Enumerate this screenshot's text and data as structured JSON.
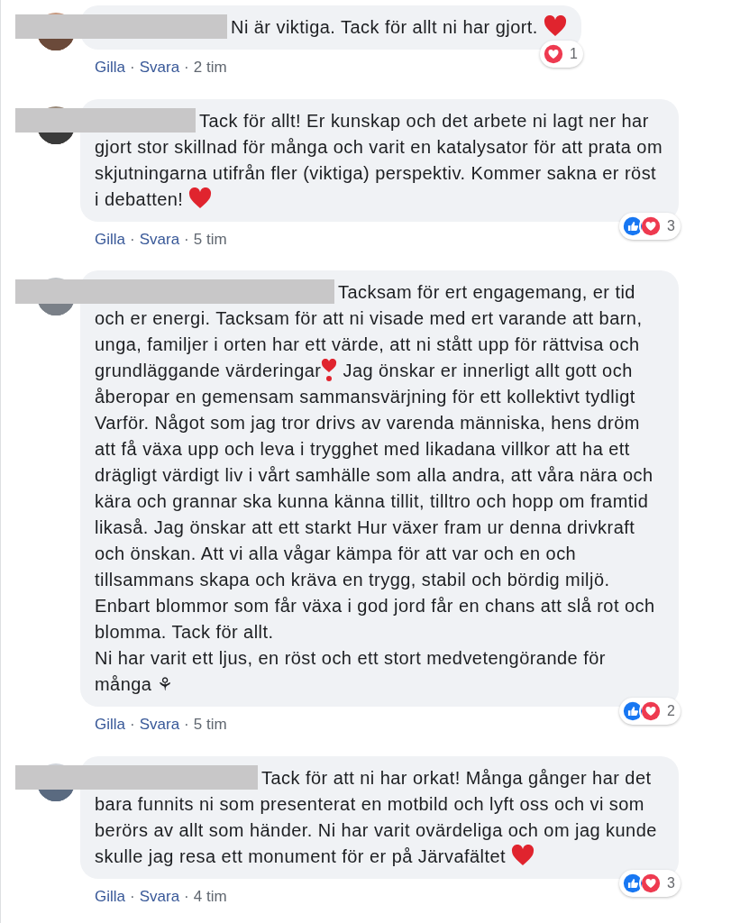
{
  "comments": [
    {
      "avatar": {
        "kind": "picture"
      },
      "name_redacted": true,
      "paragraphs": [
        [
          {
            "kind": "text",
            "text": "Ni är viktiga. Tack för allt ni har gjort. "
          },
          {
            "kind": "heart"
          }
        ]
      ],
      "reactions": {
        "icons": [
          {
            "kind": "love"
          }
        ],
        "count": "1"
      },
      "actions": {
        "like": "Gilla",
        "reply": "Svara",
        "separator": "·",
        "time": "2 tim"
      }
    },
    {
      "avatar": {
        "kind": "picture"
      },
      "name_redacted": true,
      "paragraphs": [
        [
          {
            "kind": "text",
            "text": "Tack för allt! Er kunskap och det arbete ni lagt ner har gjort stor skillnad för många och varit en katalysator för att prata om skjutningarna utifrån fler (viktiga) perspektiv. Kommer sakna er röst i debatten! "
          },
          {
            "kind": "heart"
          }
        ]
      ],
      "reactions": {
        "icons": [
          {
            "kind": "like"
          },
          {
            "kind": "love"
          }
        ],
        "count": "3"
      },
      "actions": {
        "like": "Gilla",
        "reply": "Svara",
        "separator": "·",
        "time": "5 tim"
      }
    },
    {
      "avatar": {
        "kind": "picture"
      },
      "name_redacted": true,
      "paragraphs": [
        [
          {
            "kind": "text",
            "text": "Tacksam för ert engagemang, er tid och er energi. Tacksam för att ni visade med ert varande att barn, unga, familjer i orten har ett värde, att ni stått upp för rättvisa och grundläggande värderingar"
          },
          {
            "kind": "exclamation"
          },
          {
            "kind": "text",
            "text": " Jag önskar er innerligt allt gott och åberopar en gemensam sammansvärjning för ett kollektivt tydligt Varför. Något som jag tror drivs av varenda människa, hens dröm att få växa upp och leva i trygghet med likadana villkor att ha ett drägligt värdigt liv i vårt samhälle som alla andra, att våra nära och kära och grannar ska kunna känna tillit, tilltro och hopp om framtid likaså. Jag önskar att ett starkt Hur växer fram ur denna drivkraft och önskan. Att vi alla vågar kämpa för att var och en och tillsammans skapa och kräva en trygg, stabil och bördig miljö. Enbart blommor som får växa i god jord får en chans att slå rot och blomma. Tack för allt."
          }
        ],
        [
          {
            "kind": "text",
            "text": "Ni har varit ett ljus, en röst och ett stort medvetengörande för många ⚘"
          }
        ]
      ],
      "reactions": {
        "icons": [
          {
            "kind": "like"
          },
          {
            "kind": "love"
          }
        ],
        "count": "2"
      },
      "actions": {
        "like": "Gilla",
        "reply": "Svara",
        "separator": "·",
        "time": "5 tim"
      }
    },
    {
      "avatar": {
        "kind": "picture"
      },
      "name_redacted": true,
      "paragraphs": [
        [
          {
            "kind": "text",
            "text": "Tack för att ni har orkat! Många gånger har det bara funnits ni som presenterat en motbild och lyft oss och vi som berörs av allt som händer. Ni har varit ovärdeliga och om jag kunde skulle jag resa ett monument för er på Järvafältet "
          },
          {
            "kind": "heart"
          }
        ]
      ],
      "reactions": {
        "icons": [
          {
            "kind": "like"
          },
          {
            "kind": "love"
          }
        ],
        "count": "3"
      },
      "actions": {
        "like": "Gilla",
        "reply": "Svara",
        "separator": "·",
        "time": "4 tim"
      }
    }
  ]
}
